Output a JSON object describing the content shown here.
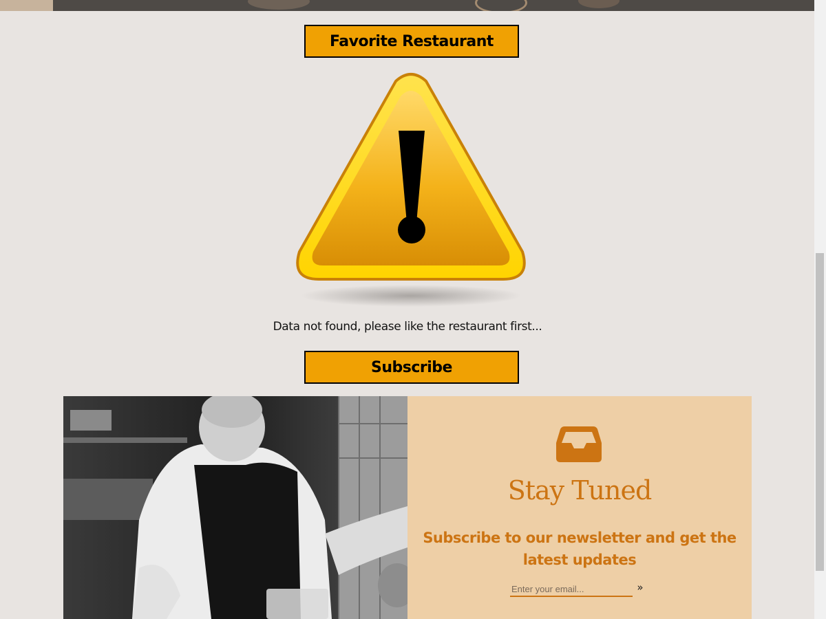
{
  "favorite_button": {
    "label": "Favorite Restaurant"
  },
  "warning": {
    "icon": "warning-triangle-icon",
    "message": "Data not found, please like the restaurant first..."
  },
  "subscribe_button": {
    "label": "Subscribe"
  },
  "newsletter": {
    "icon": "inbox-icon",
    "title": "Stay Tuned",
    "subtitle": "Subscribe to our newsletter and get the latest updates",
    "email_placeholder": "Enter your email...",
    "submit_icon": "double-chevron-right-icon",
    "submit_glyph": "»",
    "accent_color": "#cc7413",
    "panel_color": "#eecfa6"
  },
  "colors": {
    "page_background": "#e8e4e1",
    "button_background": "#f0a103"
  }
}
